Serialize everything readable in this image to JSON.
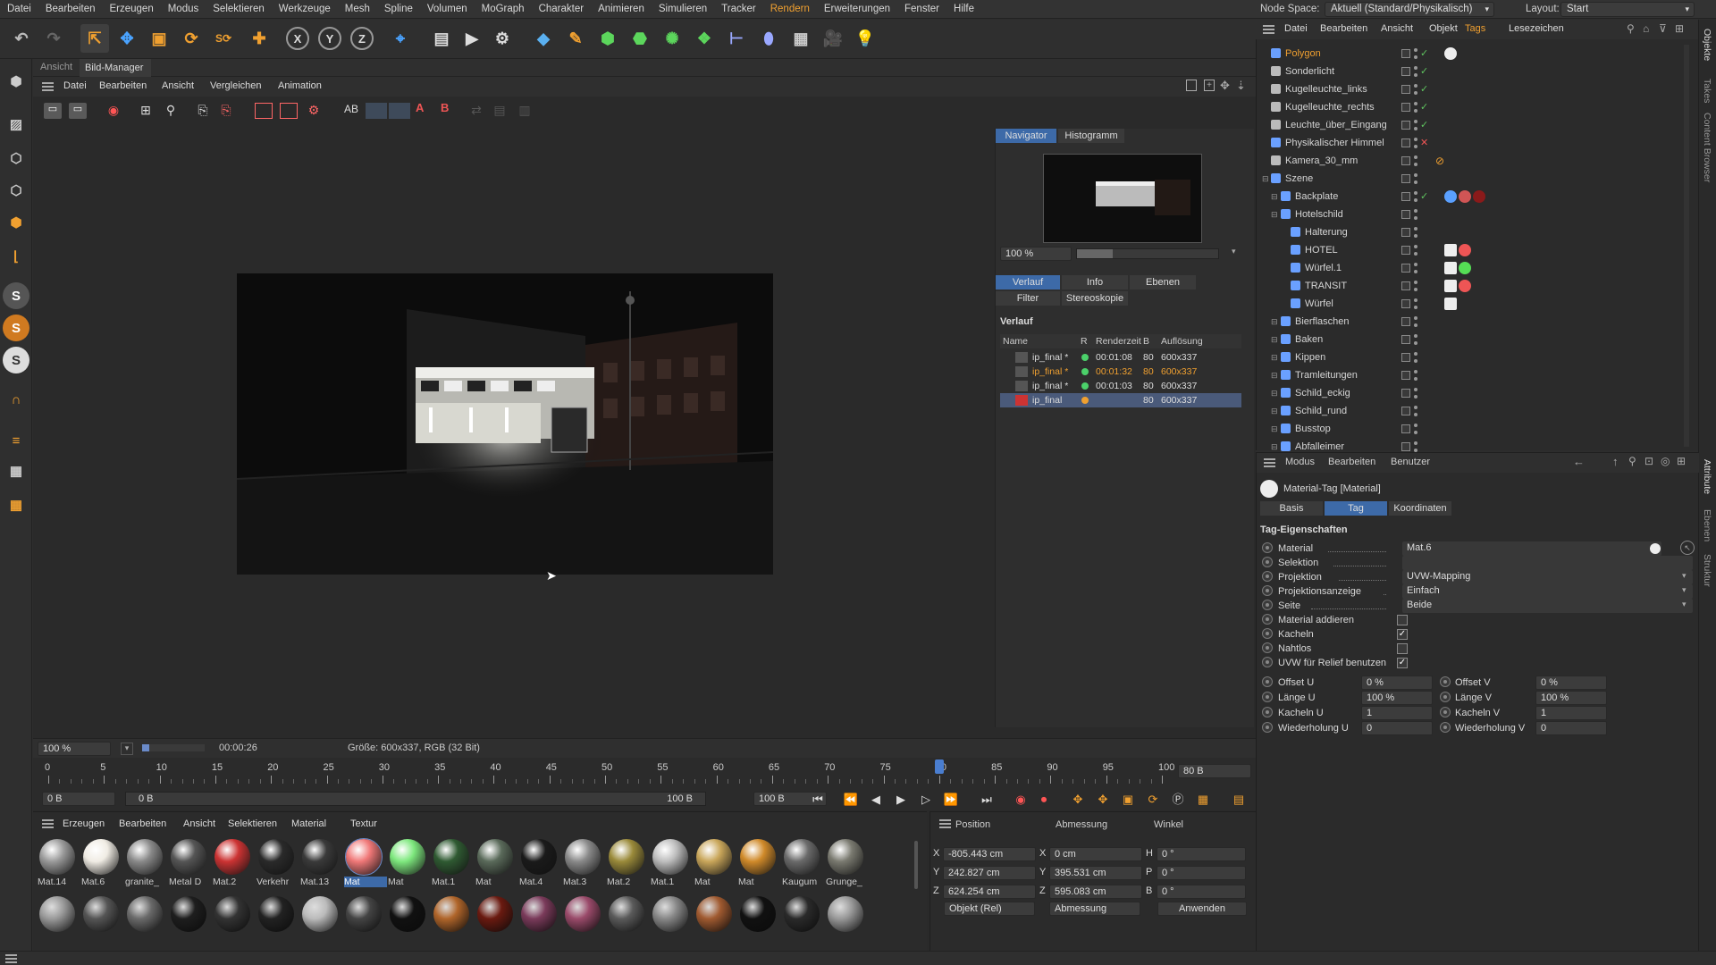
{
  "menubar": {
    "items": [
      "Datei",
      "Bearbeiten",
      "Erzeugen",
      "Modus",
      "Selektieren",
      "Werkzeuge",
      "Mesh",
      "Spline",
      "Volumen",
      "MoGraph",
      "Charakter",
      "Animieren",
      "Simulieren",
      "Tracker",
      "Rendern",
      "Erweiterungen",
      "Fenster",
      "Hilfe"
    ],
    "node_space_label": "Node Space:",
    "node_space_value": "Aktuell (Standard/Physikalisch)",
    "layout_label": "Layout:",
    "layout_value": "Start"
  },
  "picture_viewer": {
    "tabs": [
      "Ansicht",
      "Bild-Manager"
    ],
    "menu": [
      "Datei",
      "Bearbeiten",
      "Ansicht",
      "Vergleichen",
      "Animation"
    ],
    "navigator_tabs": [
      "Navigator",
      "Histogramm"
    ],
    "navigator_zoom": "100 %",
    "history_tabs": [
      "Verlauf",
      "Info",
      "Ebenen"
    ],
    "history_subtabs": [
      "Filter",
      "Stereoskopie"
    ],
    "history_title": "Verlauf",
    "history_columns": [
      "Name",
      "R",
      "Renderzeit",
      "B",
      "Auflösung"
    ],
    "history_rows": [
      {
        "name": "ip_final *",
        "time": "00:01:08",
        "frames": "80",
        "res": "600x337"
      },
      {
        "name": "ip_final *",
        "time": "00:01:32",
        "frames": "80",
        "res": "600x337"
      },
      {
        "name": "ip_final *",
        "time": "00:01:03",
        "frames": "80",
        "res": "600x337"
      },
      {
        "name": "ip_final",
        "time": "",
        "frames": "80",
        "res": "600x337"
      }
    ],
    "status_zoom": "100 %",
    "status_time": "00:00:26",
    "status_info": "Größe: 600x337, RGB (32 Bit)"
  },
  "timeline": {
    "ticks": [
      "0",
      "5",
      "10",
      "15",
      "20",
      "25",
      "30",
      "35",
      "40",
      "45",
      "50",
      "55",
      "60",
      "65",
      "70",
      "75",
      "80",
      "85",
      "90",
      "95",
      "100"
    ],
    "current_frame": "80 B",
    "start_field": "0 B",
    "range_start": "0 B",
    "range_end": "100 B",
    "end_field": "100 B"
  },
  "material_manager": {
    "menu": [
      "Erzeugen",
      "Bearbeiten",
      "Ansicht",
      "Selektieren",
      "Material",
      "Textur"
    ],
    "row1": [
      {
        "label": "Mat.14",
        "color": "#9a9a9a"
      },
      {
        "label": "Mat.6",
        "color": "#f0ece4"
      },
      {
        "label": "granite_",
        "color": "#8a8a8a"
      },
      {
        "label": "Metal D",
        "color": "#555"
      },
      {
        "label": "Mat.2",
        "color": "#c33"
      },
      {
        "label": "Verkehr",
        "color": "#2a2a2a"
      },
      {
        "label": "Mat.13",
        "color": "#3a3a3a"
      },
      {
        "label": "Mat",
        "color": "#f07878"
      },
      {
        "label": "Mat",
        "color": "#7ee87e"
      },
      {
        "label": "Mat.1",
        "color": "#2f5a32"
      },
      {
        "label": "Mat",
        "color": "#5a6a5a"
      },
      {
        "label": "Mat.4",
        "color": "#1a1a1a"
      },
      {
        "label": "Mat.3",
        "color": "#8a8a8a"
      },
      {
        "label": "Mat.2",
        "color": "#9a8a3a"
      },
      {
        "label": "Mat.1",
        "color": "#bdbdbd"
      },
      {
        "label": "Mat",
        "color": "#c9a65a"
      },
      {
        "label": "Mat",
        "color": "#d08a2a"
      },
      {
        "label": "Kaugum",
        "color": "#6a6a6a"
      },
      {
        "label": "Grunge_",
        "color": "#7a7a70"
      }
    ],
    "row2_colors": [
      "#9a9a9a",
      "#555",
      "#6a6a6a",
      "#1e1e1e",
      "#333",
      "#222",
      "#bbb",
      "#444",
      "#111",
      "#b0652a",
      "#6a1a10",
      "#7a3a5a",
      "#9a4a6a",
      "#5a5a5a",
      "#888",
      "#a05a30",
      "#111",
      "#2a2a2a",
      "#999"
    ]
  },
  "coordinates": {
    "headers": [
      "Position",
      "Abmessung",
      "Winkel"
    ],
    "rows": [
      {
        "axis": "X",
        "pos": "-805.443 cm",
        "dim_axis": "X",
        "dim": "0 cm",
        "ang_axis": "H",
        "ang": "0 °"
      },
      {
        "axis": "Y",
        "pos": "242.827 cm",
        "dim_axis": "Y",
        "dim": "395.531 cm",
        "ang_axis": "P",
        "ang": "0 °"
      },
      {
        "axis": "Z",
        "pos": "624.254 cm",
        "dim_axis": "Z",
        "dim": "595.083 cm",
        "ang_axis": "B",
        "ang": "0 °"
      }
    ],
    "mode_select": "Objekt (Rel)",
    "size_select": "Abmessung",
    "apply_label": "Anwenden"
  },
  "object_manager": {
    "menu": [
      "Datei",
      "Bearbeiten",
      "Ansicht",
      "Objekt",
      "Tags",
      "Lesezeichen"
    ],
    "rows": [
      {
        "name": "Polygon",
        "indent": 0,
        "selected": true
      },
      {
        "name": "Sonderlicht",
        "indent": 0
      },
      {
        "name": "Kugelleuchte_links",
        "indent": 0
      },
      {
        "name": "Kugelleuchte_rechts",
        "indent": 0
      },
      {
        "name": "Leuchte_über_Eingang",
        "indent": 0
      },
      {
        "name": "Physikalischer Himmel",
        "indent": 0
      },
      {
        "name": "Kamera_30_mm",
        "indent": 0
      },
      {
        "name": "Szene",
        "indent": 0
      },
      {
        "name": "Backplate",
        "indent": 1
      },
      {
        "name": "Hotelschild",
        "indent": 1
      },
      {
        "name": "Halterung",
        "indent": 2
      },
      {
        "name": "HOTEL",
        "indent": 2
      },
      {
        "name": "Würfel.1",
        "indent": 2
      },
      {
        "name": "TRANSIT",
        "indent": 2
      },
      {
        "name": "Würfel",
        "indent": 2
      },
      {
        "name": "Bierflaschen",
        "indent": 1
      },
      {
        "name": "Baken",
        "indent": 1
      },
      {
        "name": "Kippen",
        "indent": 1
      },
      {
        "name": "Tramleitungen",
        "indent": 1
      },
      {
        "name": "Schild_eckig",
        "indent": 1
      },
      {
        "name": "Schild_rund",
        "indent": 1
      },
      {
        "name": "Busstop",
        "indent": 1
      },
      {
        "name": "Abfalleimer",
        "indent": 1
      }
    ],
    "side_tabs": [
      "Objekte",
      "Takes",
      "Content Browser"
    ]
  },
  "attributes": {
    "menu": [
      "Modus",
      "Bearbeiten",
      "Benutzer"
    ],
    "title": "Material-Tag [Material]",
    "tabs": [
      "Basis",
      "Tag",
      "Koordinaten"
    ],
    "section": "Tag-Eigenschaften",
    "props": [
      {
        "label": "Material",
        "value": "Mat.6"
      },
      {
        "label": "Selektion",
        "value": ""
      },
      {
        "label": "Projektion",
        "value": "UVW-Mapping"
      },
      {
        "label": "Projektionsanzeige",
        "value": "Einfach"
      },
      {
        "label": "Seite",
        "value": "Beide"
      }
    ],
    "checks": [
      {
        "label": "Material addieren",
        "checked": false
      },
      {
        "label": "Kacheln",
        "checked": true
      },
      {
        "label": "Nahtlos",
        "checked": false
      },
      {
        "label": "UVW für Relief benutzen",
        "checked": true
      }
    ],
    "pairs": [
      {
        "l1": "Offset U",
        "v1": "0 %",
        "l2": "Offset V",
        "v2": "0 %"
      },
      {
        "l1": "Länge U",
        "v1": "100 %",
        "l2": "Länge V",
        "v2": "100 %"
      },
      {
        "l1": "Kacheln U",
        "v1": "1",
        "l2": "Kacheln V",
        "v2": "1"
      },
      {
        "l1": "Wiederholung U",
        "v1": "0",
        "l2": "Wiederholung V",
        "v2": "0"
      }
    ],
    "side_tabs": [
      "Attribute",
      "Ebenen",
      "Struktur"
    ]
  }
}
